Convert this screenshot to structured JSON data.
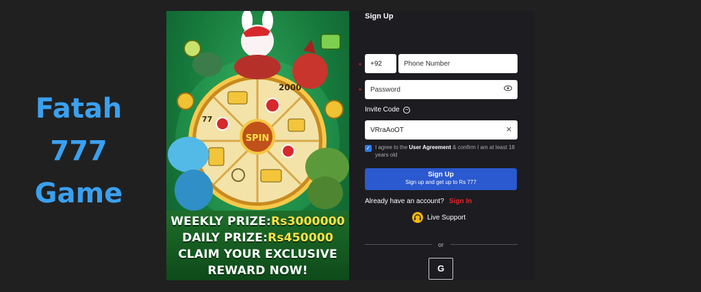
{
  "side_title": {
    "line1": "Fatah",
    "line2": "777",
    "line3": "Game"
  },
  "promo": {
    "wheel_label": "SPIN",
    "wheel_number_top": "2000",
    "wheel_number_left": "77",
    "coin_symbol": "Rs",
    "weekly_label": "WEEKLY PRIZE:",
    "weekly_amount": "Rs3000000",
    "daily_label": "DAILY PRIZE:",
    "daily_amount": "Rs450000",
    "claim_line1": "CLAIM YOUR EXCLUSIVE",
    "claim_line2": "REWARD NOW!"
  },
  "form": {
    "title": "Sign Up",
    "country_code": "+92",
    "phone_placeholder": "Phone Number",
    "password_placeholder": "Password",
    "invite_label": "Invite Code",
    "invite_value": "VRraAoOT",
    "agree_prefix": "I agree to the",
    "agree_link": "User Agreement",
    "agree_suffix": "& confirm I am at least 18 years old",
    "signup_main": "Sign Up",
    "signup_sub": "Sign up and get up to Rs 777",
    "have_account": "Already have an account?",
    "signin_label": "Sign In",
    "live_support": "Live Support",
    "or_text": "or",
    "google_letter": "G"
  },
  "colors": {
    "accent_blue": "#2b59cf",
    "title_blue": "#3aa0f0",
    "signin_red": "#e0262d",
    "prize_yellow": "#ffe14a"
  }
}
